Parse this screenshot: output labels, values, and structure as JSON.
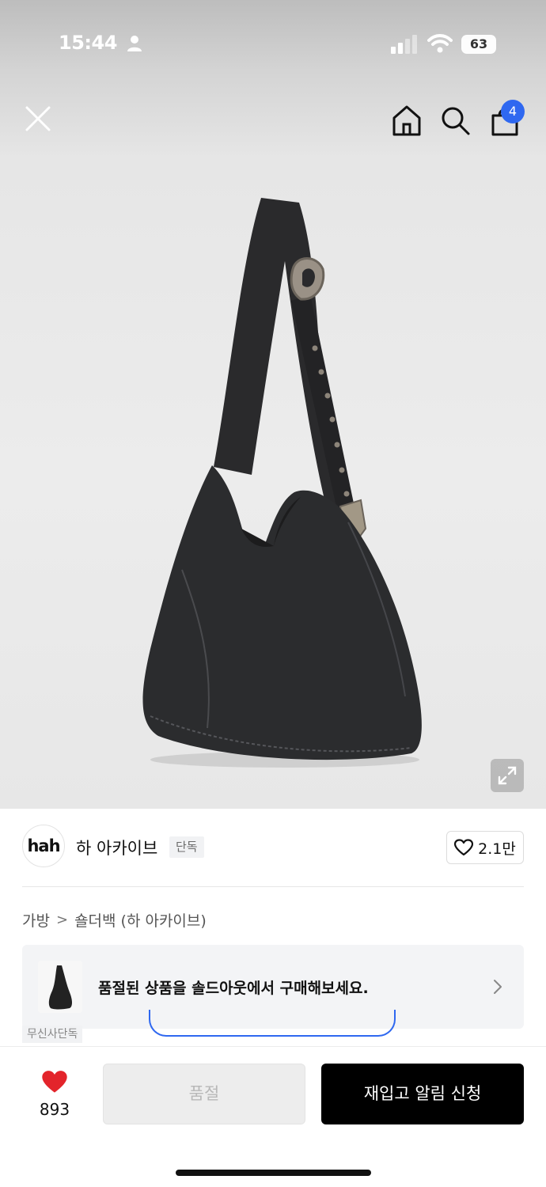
{
  "status_bar": {
    "time": "15:44",
    "battery": "63"
  },
  "header": {
    "cart_count": "4"
  },
  "product": {
    "brand_logo_text": "hah",
    "brand_name": "하 아카이브",
    "exclusive_label": "단독",
    "likes": "2.1만"
  },
  "breadcrumb": {
    "category": "가방",
    "separator": ">",
    "subcategory": "숄더백 (하 아카이브)"
  },
  "soldout_banner": {
    "text": "품절된 상품을 솔드아웃에서 구매해보세요."
  },
  "peek": {
    "tag_text": "무신사단독"
  },
  "bottom_bar": {
    "wish_count": "893",
    "soldout_label": "품절",
    "restock_label": "재입고 알림 신청"
  },
  "colors": {
    "accent_blue": "#2f68f0",
    "heart_red": "#e3242b",
    "primary_button": "#000000"
  },
  "icons": [
    "person-icon",
    "signal-icon",
    "wifi-icon",
    "close-icon",
    "home-icon",
    "search-icon",
    "cart-icon",
    "expand-icon",
    "heart-outline-icon",
    "chevron-right-icon",
    "heart-filled-icon"
  ]
}
